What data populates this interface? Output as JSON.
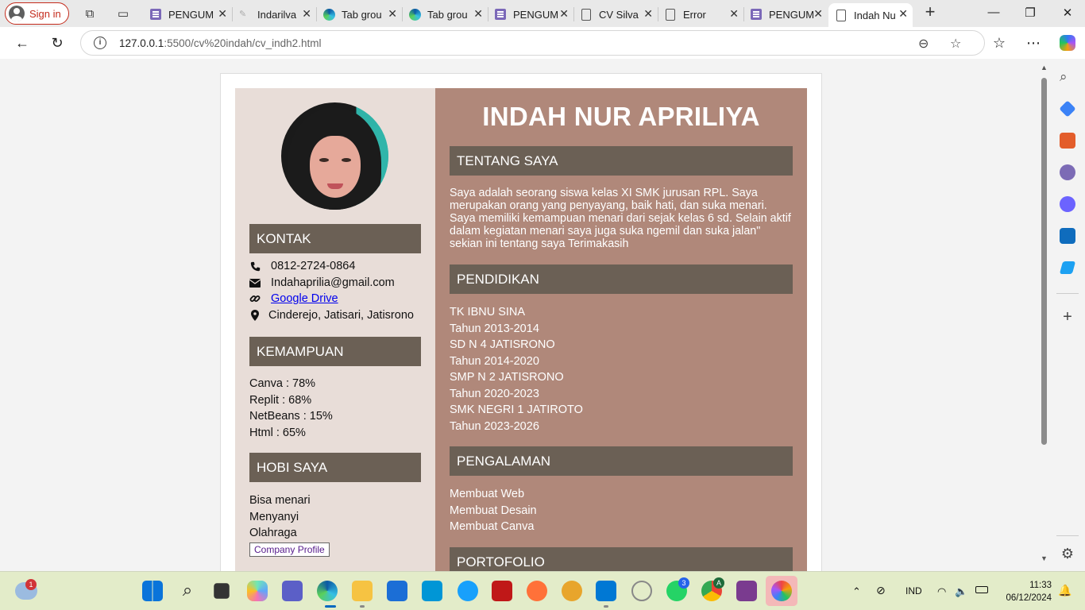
{
  "browser": {
    "signin_label": "Sign in",
    "tabs": [
      {
        "title": "PENGUM",
        "icon": "forms-icon"
      },
      {
        "title": "Indarilva",
        "icon": "image-icon"
      },
      {
        "title": "Tab grou",
        "icon": "edge-icon"
      },
      {
        "title": "Tab grou",
        "icon": "edge-icon"
      },
      {
        "title": "PENGUM",
        "icon": "forms-icon"
      },
      {
        "title": "CV Silva",
        "icon": "document-icon"
      },
      {
        "title": "Error",
        "icon": "document-icon"
      },
      {
        "title": "PENGUM",
        "icon": "forms-icon"
      },
      {
        "title": "Indah Nu",
        "icon": "document-icon",
        "active": true
      }
    ],
    "url_host": "127.0.0.1",
    "url_path": ":5500/cv%20indah/cv_indh2.html"
  },
  "cv": {
    "name": "INDAH NUR APRILIYA",
    "left": {
      "contact_title": "KONTAK",
      "phone": "0812-2724-0864",
      "email": "Indahaprilia@gmail.com",
      "drive": "Google Drive",
      "address": "Cinderejo, Jatisari, Jatisrono",
      "skills_title": "KEMAMPUAN",
      "skills": [
        "Canva : 78%",
        "Replit : 68%",
        "NetBeans : 15%",
        "Html : 65%"
      ],
      "hobbies_title": "HOBI SAYA",
      "hobbies": [
        "Bisa menari",
        "Menyanyi",
        "Olahraga"
      ],
      "company_button": "Company Profile"
    },
    "right": {
      "about_title": "TENTANG SAYA",
      "about_text": "Saya adalah seorang siswa kelas XI SMK jurusan RPL. Saya merupakan orang yang penyayang, baik hati, dan suka menari. Saya memiliki kemampuan menari dari sejak kelas 6 sd. Selain aktif dalam kegiatan menari saya juga suka ngemil dan suka jalan\" sekian ini tentang saya Terimakasih",
      "education_title": "PENDIDIKAN",
      "education": [
        "TK IBNU SINA",
        "Tahun 2013-2014",
        "SD N 4 JATISRONO",
        "Tahun 2014-2020",
        "SMP N 2 JATISRONO",
        "Tahun 2020-2023",
        "SMK NEGRI 1 JATIROTO",
        "Tahun 2023-2026"
      ],
      "experience_title": "PENGALAMAN",
      "experience": [
        "Membuat Web",
        "Membuat Desain",
        "Membuat Canva"
      ],
      "portfolio_title": "PORTOFOLIO"
    }
  },
  "taskbar": {
    "weather_badge": "1",
    "teams_badge": "3",
    "chrome_badge": "A",
    "lang": "IND",
    "time": "11:33",
    "date": "06/12/2024"
  },
  "colors": {
    "left_bg": "#e8ddd8",
    "right_bg": "#b0887a",
    "section_header": "#6b6055"
  }
}
